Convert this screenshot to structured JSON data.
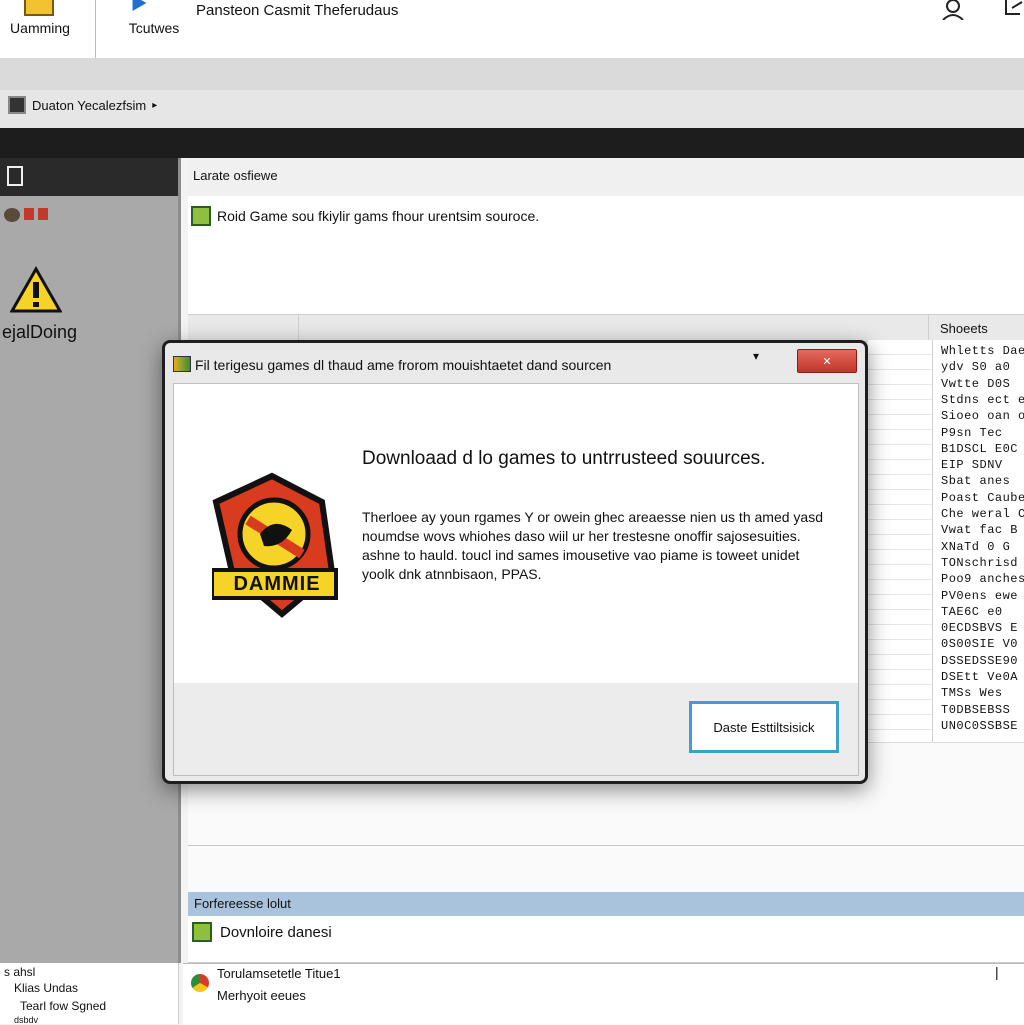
{
  "toolbar": {
    "btn1_label": "Uamming",
    "btn2_label": "Tcutwes",
    "title": "Pansteon Casmit Theferudaus"
  },
  "app": {
    "title": "Duaton Yecalezfsim"
  },
  "sidebar": {
    "warning_label": "ejalDoing"
  },
  "main": {
    "top_label": "Larate osfiewe",
    "item_text": "Roid Game sou fkiylir gams fhour urentsim souroce.",
    "column_header": "Shoeets",
    "right_list": [
      "Whletts Daes",
      "ydv S0 a0",
      "Vwtte D0S",
      "Stdns ect e",
      "Sioeo oan o",
      "P9sn  Tec",
      "B1DSCL  E0C",
      "EIP  SDNV",
      "Sbat  anes",
      "Poast Caube",
      "Che  weral C",
      "Vwat  fac  B",
      "XNaTd  0  G",
      "TONschrisd",
      "Poo9 anches",
      "PV0ens  ewe",
      "TAE6C  e0",
      "0ECDSBVS  E",
      "0S00SIE  V0",
      "DSSEDSSE90",
      "DSEtt  Ve0A",
      "TMSs  Wes",
      "T0DBSEBSS",
      "UN0C0SSBSE"
    ],
    "status_bar": "Forfereesse lolut",
    "download_row": "Dovnloire danesi"
  },
  "bottom": {
    "left_lines": [
      "s ahsl",
      "Klias  Undas",
      "Tearl fow Sgned",
      "dsbdv"
    ],
    "main_line1": "Torulamsetetle Titue1",
    "main_line2": "Merhyoit eeues"
  },
  "dialog": {
    "title": "Fil terigesu games dl thaud ame frorom mouishtaetet dand sourcen",
    "heading": "Downloaad d lo games to untrrusteed souurces.",
    "body": "Therloee ay youn rgames Y or owein ghec areaesse nien us th amed yasd noumdse wovs whiohes daso wiil ur her trestesne onoffir sajosesuities. ashne to hauld. toucl ind sames imousetive vao piame is toweet unidet yoolk dnk atnnbisaon, PPAS.",
    "logo_text": "DAMMIE",
    "button_label": "Daste Esttiltsisick"
  },
  "colors": {
    "accent_button_border": "#3da0c9",
    "close_button": "#d2443a",
    "status_bar": "#a9c3dd",
    "warning_yellow": "#f5d327"
  }
}
